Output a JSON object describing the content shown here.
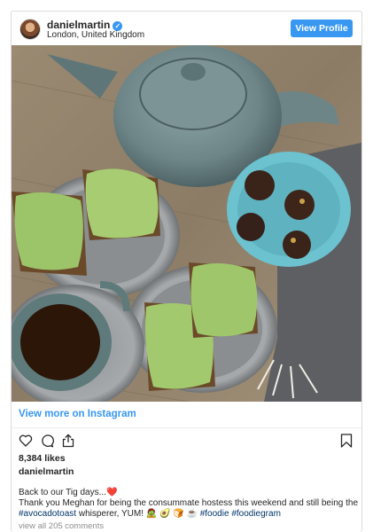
{
  "header": {
    "username": "danielmartin",
    "location": "London, United Kingdom",
    "view_profile_label": "View Profile",
    "verified": true
  },
  "post": {
    "view_more_label": "View more on Instagram",
    "likes": "8,384 likes",
    "author": "danielmartin",
    "caption_line1": "Back to our Tig days...",
    "caption_line2": "Thank you Meghan for being the consummate hostess this weekend and still being the",
    "hashtag_avocadotoast": "#avocadotoast",
    "caption_line3_rest": " whisperer, YUM! 🧟 🥑 🍞 ☕ ",
    "hashtag_foodie": "#foodie",
    "hashtag_foodiegram": "#foodiegram",
    "comments_label": "view all 205 comments"
  },
  "icons": {
    "like": "heart-icon",
    "comment": "comment-icon",
    "share": "share-icon",
    "save": "bookmark-icon",
    "verified": "verified-badge-icon",
    "caption_heart": "red-heart-emoji"
  },
  "colors": {
    "accent": "#3897f0",
    "hashtag": "#003569",
    "heart": "#e0245e",
    "muted": "#8e8e8e"
  }
}
